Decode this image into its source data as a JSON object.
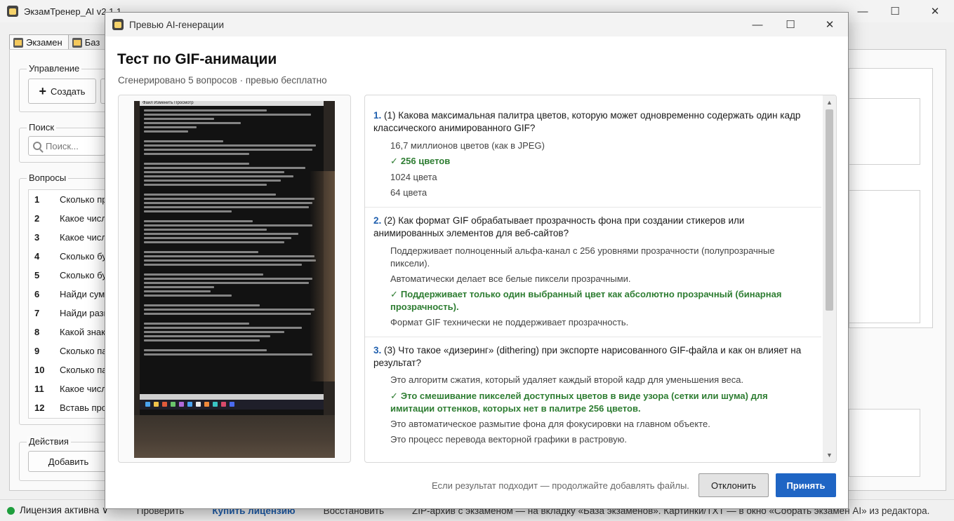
{
  "main_window": {
    "title": "ЭкзамТренер_AI v2.1.1",
    "tabs": [
      "Экзамен",
      "Баз"
    ],
    "groups": {
      "manage": "Управление",
      "search": "Поиск",
      "questions": "Вопросы",
      "actions": "Действия"
    },
    "create_button": "Создать",
    "search_placeholder": "Поиск...",
    "add_button": "Добавить",
    "question_list": [
      {
        "num": "1",
        "text": "Сколько пр"
      },
      {
        "num": "2",
        "text": "Какое числ"
      },
      {
        "num": "3",
        "text": "Какое числ"
      },
      {
        "num": "4",
        "text": "Сколько бу"
      },
      {
        "num": "5",
        "text": "Сколько бу"
      },
      {
        "num": "6",
        "text": "Найди сум"
      },
      {
        "num": "7",
        "text": "Найди разн"
      },
      {
        "num": "8",
        "text": "Какой знак"
      },
      {
        "num": "9",
        "text": "Сколько па"
      },
      {
        "num": "10",
        "text": "Сколько па"
      },
      {
        "num": "11",
        "text": "Какое числ"
      },
      {
        "num": "12",
        "text": "Вставь про"
      }
    ],
    "status": {
      "license": "Лицензия активна ∨",
      "check": "Проверить",
      "buy": "Купить лицензию",
      "restore": "Восстановить",
      "hint": "ZIP-архив с экзаменом — на вкладку «База экзаменов». Картинки/TXT — в окно «Собрать экзамен AI» из редактора."
    }
  },
  "dialog": {
    "title": "Превью AI-генерации",
    "heading": "Тест по GIF-анимации",
    "subheading": "Сгенерировано 5 вопросов · превью бесплатно",
    "photo_menu": "Файл   Изменить   Просмотр",
    "questions": [
      {
        "num": "1.",
        "text": "(1) Какова максимальная палитра цветов, которую может одновременно содержать один кадр классического анимированного GIF?",
        "options": [
          {
            "text": "16,7 миллионов цветов (как в JPEG)",
            "correct": false
          },
          {
            "text": "256 цветов",
            "correct": true
          },
          {
            "text": "1024 цвета",
            "correct": false
          },
          {
            "text": "64 цвета",
            "correct": false
          }
        ]
      },
      {
        "num": "2.",
        "text": "(2) Как формат GIF обрабатывает прозрачность фона при создании стикеров или анимированных элементов для веб-сайтов?",
        "options": [
          {
            "text": "Поддерживает полноценный альфа-канал с 256 уровнями прозрачности (полупрозрачные пиксели).",
            "correct": false
          },
          {
            "text": "Автоматически делает все белые пиксели прозрачными.",
            "correct": false
          },
          {
            "text": "Поддерживает только один выбранный цвет как абсолютно прозрачный (бинарная прозрачность).",
            "correct": true
          },
          {
            "text": "Формат GIF технически не поддерживает прозрачность.",
            "correct": false
          }
        ]
      },
      {
        "num": "3.",
        "text": "(3) Что такое «дизеринг» (dithering) при экспорте нарисованного GIF-файла и как он влияет на результат?",
        "options": [
          {
            "text": "Это алгоритм сжатия, который удаляет каждый второй кадр для уменьшения веса.",
            "correct": false
          },
          {
            "text": "Это смешивание пикселей доступных цветов в виде узора (сетки или шума) для имитации оттенков, которых нет в палитре 256 цветов.",
            "correct": true
          },
          {
            "text": "Это автоматическое размытие фона для фокусировки на главном объекте.",
            "correct": false
          },
          {
            "text": "Это процесс перевода векторной графики в растровую.",
            "correct": false
          }
        ]
      }
    ],
    "check_mark": "✓",
    "footer_note": "Если результат подходит — продолжайте добавлять файлы.",
    "reject_button": "Отклонить",
    "accept_button": "Принять"
  }
}
